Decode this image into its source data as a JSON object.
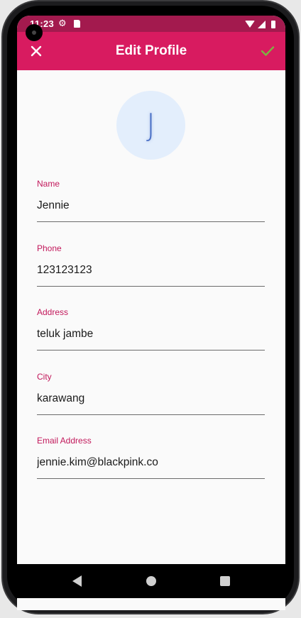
{
  "status_bar": {
    "time": "11:23",
    "icons": [
      "gear-icon",
      "sd-card-icon",
      "wifi-icon",
      "signal-icon",
      "battery-icon"
    ]
  },
  "app_bar": {
    "title": "Edit Profile",
    "close_icon": "close-icon",
    "confirm_icon": "check-icon",
    "color": "#d81b60"
  },
  "avatar": {
    "initial": "J",
    "background": "#e3eefc"
  },
  "form": {
    "name": {
      "label": "Name",
      "value": "Jennie"
    },
    "phone": {
      "label": "Phone",
      "value": "123123123"
    },
    "address": {
      "label": "Address",
      "value": "teluk jambe"
    },
    "city": {
      "label": "City",
      "value": "karawang"
    },
    "email": {
      "label": "Email Address",
      "value": "jennie.kim@blackpink.co"
    }
  },
  "nav_bar": {
    "icons": [
      "back-icon",
      "home-icon",
      "recents-icon"
    ]
  },
  "colors": {
    "accent": "#d81b60",
    "status_bar": "#a31a4e",
    "label": "#c2185b"
  }
}
